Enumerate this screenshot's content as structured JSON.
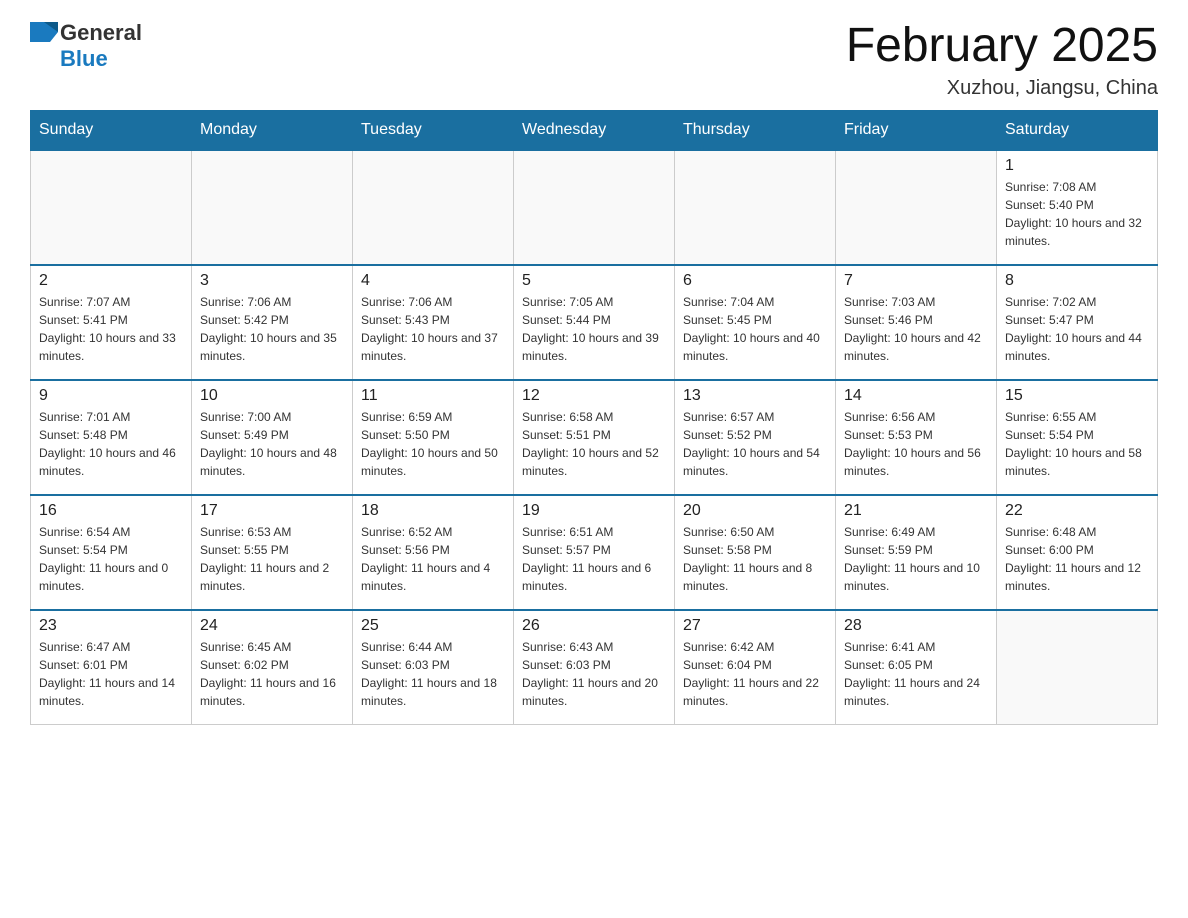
{
  "header": {
    "logo_general": "General",
    "logo_blue": "Blue",
    "month_title": "February 2025",
    "location": "Xuzhou, Jiangsu, China"
  },
  "weekdays": [
    "Sunday",
    "Monday",
    "Tuesday",
    "Wednesday",
    "Thursday",
    "Friday",
    "Saturday"
  ],
  "weeks": [
    [
      {
        "day": "",
        "info": ""
      },
      {
        "day": "",
        "info": ""
      },
      {
        "day": "",
        "info": ""
      },
      {
        "day": "",
        "info": ""
      },
      {
        "day": "",
        "info": ""
      },
      {
        "day": "",
        "info": ""
      },
      {
        "day": "1",
        "info": "Sunrise: 7:08 AM\nSunset: 5:40 PM\nDaylight: 10 hours and 32 minutes."
      }
    ],
    [
      {
        "day": "2",
        "info": "Sunrise: 7:07 AM\nSunset: 5:41 PM\nDaylight: 10 hours and 33 minutes."
      },
      {
        "day": "3",
        "info": "Sunrise: 7:06 AM\nSunset: 5:42 PM\nDaylight: 10 hours and 35 minutes."
      },
      {
        "day": "4",
        "info": "Sunrise: 7:06 AM\nSunset: 5:43 PM\nDaylight: 10 hours and 37 minutes."
      },
      {
        "day": "5",
        "info": "Sunrise: 7:05 AM\nSunset: 5:44 PM\nDaylight: 10 hours and 39 minutes."
      },
      {
        "day": "6",
        "info": "Sunrise: 7:04 AM\nSunset: 5:45 PM\nDaylight: 10 hours and 40 minutes."
      },
      {
        "day": "7",
        "info": "Sunrise: 7:03 AM\nSunset: 5:46 PM\nDaylight: 10 hours and 42 minutes."
      },
      {
        "day": "8",
        "info": "Sunrise: 7:02 AM\nSunset: 5:47 PM\nDaylight: 10 hours and 44 minutes."
      }
    ],
    [
      {
        "day": "9",
        "info": "Sunrise: 7:01 AM\nSunset: 5:48 PM\nDaylight: 10 hours and 46 minutes."
      },
      {
        "day": "10",
        "info": "Sunrise: 7:00 AM\nSunset: 5:49 PM\nDaylight: 10 hours and 48 minutes."
      },
      {
        "day": "11",
        "info": "Sunrise: 6:59 AM\nSunset: 5:50 PM\nDaylight: 10 hours and 50 minutes."
      },
      {
        "day": "12",
        "info": "Sunrise: 6:58 AM\nSunset: 5:51 PM\nDaylight: 10 hours and 52 minutes."
      },
      {
        "day": "13",
        "info": "Sunrise: 6:57 AM\nSunset: 5:52 PM\nDaylight: 10 hours and 54 minutes."
      },
      {
        "day": "14",
        "info": "Sunrise: 6:56 AM\nSunset: 5:53 PM\nDaylight: 10 hours and 56 minutes."
      },
      {
        "day": "15",
        "info": "Sunrise: 6:55 AM\nSunset: 5:54 PM\nDaylight: 10 hours and 58 minutes."
      }
    ],
    [
      {
        "day": "16",
        "info": "Sunrise: 6:54 AM\nSunset: 5:54 PM\nDaylight: 11 hours and 0 minutes."
      },
      {
        "day": "17",
        "info": "Sunrise: 6:53 AM\nSunset: 5:55 PM\nDaylight: 11 hours and 2 minutes."
      },
      {
        "day": "18",
        "info": "Sunrise: 6:52 AM\nSunset: 5:56 PM\nDaylight: 11 hours and 4 minutes."
      },
      {
        "day": "19",
        "info": "Sunrise: 6:51 AM\nSunset: 5:57 PM\nDaylight: 11 hours and 6 minutes."
      },
      {
        "day": "20",
        "info": "Sunrise: 6:50 AM\nSunset: 5:58 PM\nDaylight: 11 hours and 8 minutes."
      },
      {
        "day": "21",
        "info": "Sunrise: 6:49 AM\nSunset: 5:59 PM\nDaylight: 11 hours and 10 minutes."
      },
      {
        "day": "22",
        "info": "Sunrise: 6:48 AM\nSunset: 6:00 PM\nDaylight: 11 hours and 12 minutes."
      }
    ],
    [
      {
        "day": "23",
        "info": "Sunrise: 6:47 AM\nSunset: 6:01 PM\nDaylight: 11 hours and 14 minutes."
      },
      {
        "day": "24",
        "info": "Sunrise: 6:45 AM\nSunset: 6:02 PM\nDaylight: 11 hours and 16 minutes."
      },
      {
        "day": "25",
        "info": "Sunrise: 6:44 AM\nSunset: 6:03 PM\nDaylight: 11 hours and 18 minutes."
      },
      {
        "day": "26",
        "info": "Sunrise: 6:43 AM\nSunset: 6:03 PM\nDaylight: 11 hours and 20 minutes."
      },
      {
        "day": "27",
        "info": "Sunrise: 6:42 AM\nSunset: 6:04 PM\nDaylight: 11 hours and 22 minutes."
      },
      {
        "day": "28",
        "info": "Sunrise: 6:41 AM\nSunset: 6:05 PM\nDaylight: 11 hours and 24 minutes."
      },
      {
        "day": "",
        "info": ""
      }
    ]
  ]
}
